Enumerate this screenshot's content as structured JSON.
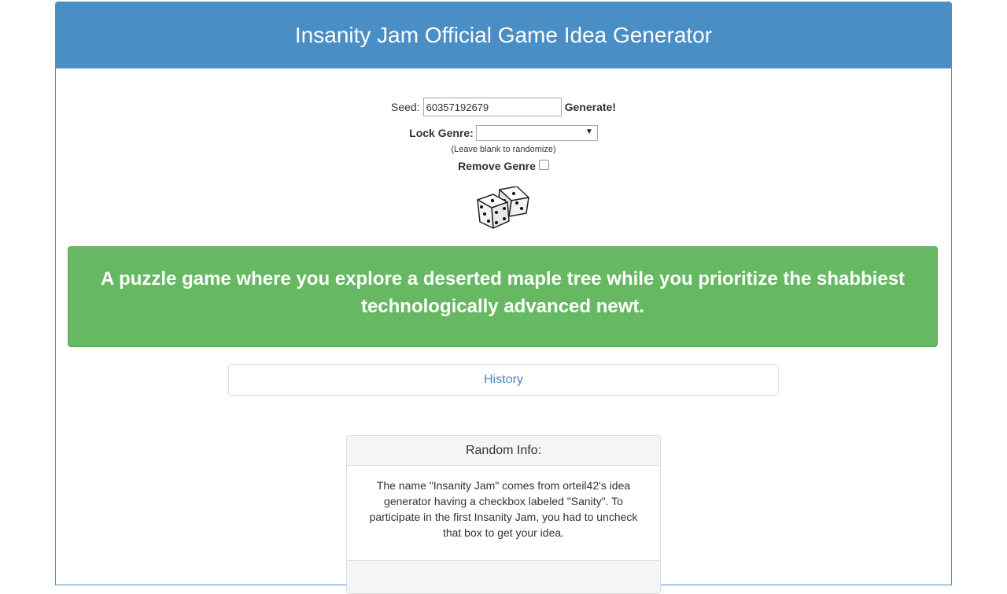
{
  "header": {
    "title": "Insanity Jam Official Game Idea Generator"
  },
  "controls": {
    "seed_label": "Seed:",
    "seed_value": "60357192679",
    "generate_label": "Generate!",
    "lock_genre_label": "Lock Genre:",
    "lock_genre_value": "",
    "hint": "(Leave blank to randomize)",
    "remove_genre_label": "Remove Genre",
    "remove_genre_checked": false
  },
  "dice_icon": "dice-icon",
  "idea": {
    "text": "A puzzle game where you explore a deserted maple tree while you prioritize the shabbiest technologically advanced newt."
  },
  "history": {
    "label": "History"
  },
  "random_info": {
    "heading": "Random Info:",
    "body": "The name \"Insanity Jam\" comes from orteil42's idea generator having a checkbox labeled \"Sanity\". To participate in the first Insanity Jam, you had to uncheck that box to get your idea."
  },
  "colors": {
    "header_bg": "#4a8ec6",
    "idea_bg": "#66b863",
    "link": "#4a86c1"
  }
}
